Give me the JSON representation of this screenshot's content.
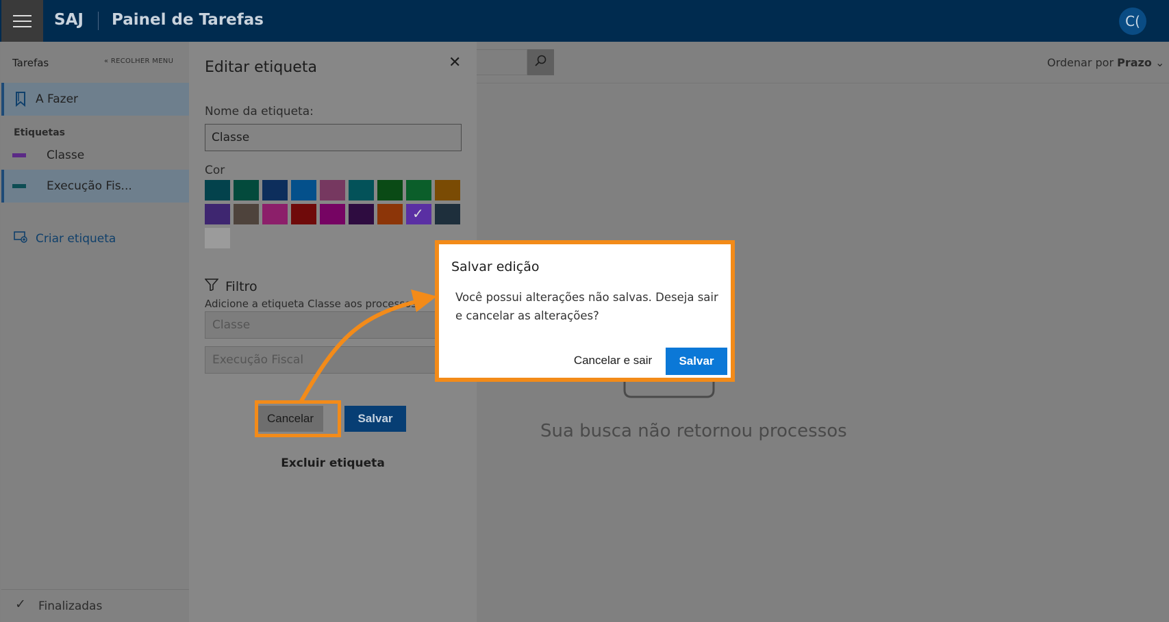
{
  "topbar": {
    "brand": "SAJ",
    "title": "Painel de Tarefas",
    "avatar_initials": "C("
  },
  "sidebar": {
    "title": "Tarefas",
    "collapse_label": "RECOLHER MENU",
    "todo_label": "A Fazer",
    "section_label": "Etiquetas",
    "tags": [
      {
        "label": "Classe",
        "color": "#5b2a86"
      },
      {
        "label": "Execução Fis...",
        "color": "#0d4d54"
      }
    ],
    "create_label": "Criar etiqueta",
    "footer_label": "Finalizadas"
  },
  "panel": {
    "title": "Editar etiqueta",
    "name_label": "Nome da etiqueta:",
    "name_value": "Classe",
    "color_label": "Cor",
    "colors": [
      "#03424c",
      "#034a3c",
      "#0d2e5c",
      "#04508b",
      "#763860",
      "#035259",
      "#0a4a15",
      "#0b5e2a",
      "#7a4b04",
      "#3e2670",
      "#4e433c",
      "#8c1f6a",
      "#6f0a0a",
      "#760463",
      "#2e0c40",
      "#8c3508",
      "#5a2fa3",
      "#1e2f3c",
      "#9b9b9b"
    ],
    "selected_color_index": 16,
    "filter_title": "Filtro",
    "filter_desc": "Adicione a etiqueta Classe aos processos",
    "filter_class_placeholder": "Classe",
    "filter_value_placeholder": "Execução Fiscal",
    "cancel_label": "Cancelar",
    "save_label": "Salvar",
    "delete_label": "Excluir etiqueta"
  },
  "main": {
    "sort_prefix": "Ordenar por",
    "sort_value": "Prazo",
    "empty_message": "Sua busca não retornou processos"
  },
  "dialog": {
    "title": "Salvar edição",
    "message": "Você possui alterações não salvas. Deseja sair e cancelar as alterações?",
    "cancel_label": "Cancelar e sair",
    "save_label": "Salvar"
  },
  "annotation_color": "#f38b19"
}
